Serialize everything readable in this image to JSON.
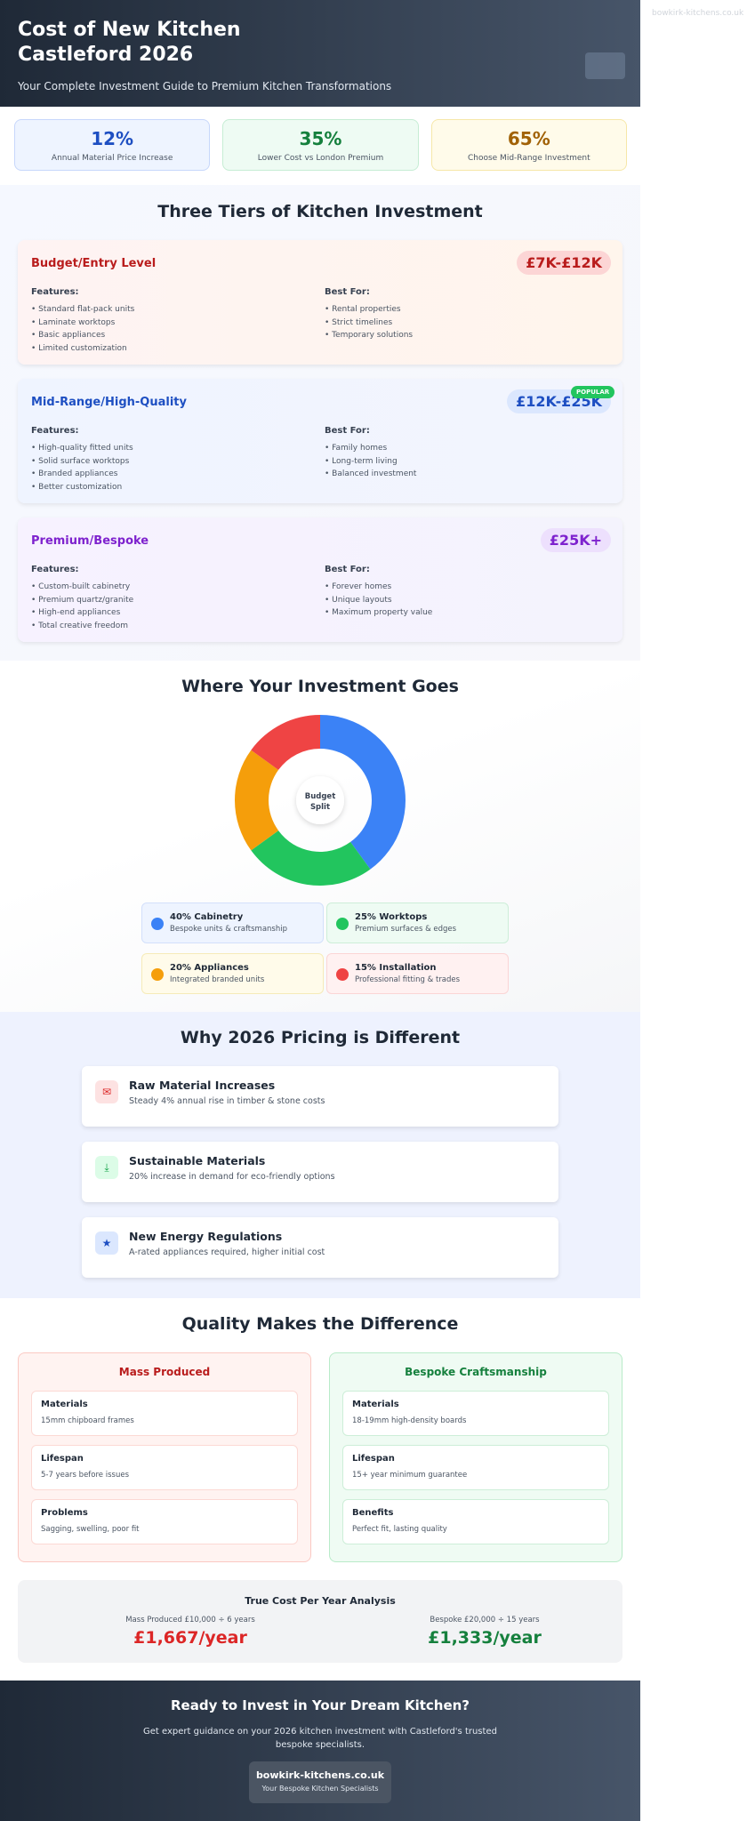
{
  "watermark": "bowkirk-kitchens.co.uk",
  "header": {
    "title": "Cost of New Kitchen Castleford 2026",
    "subtitle": "Your Complete Investment Guide to Premium Kitchen Transformations"
  },
  "stats": [
    {
      "value": "12%",
      "label": "Annual Material Price Increase"
    },
    {
      "value": "35%",
      "label": "Lower Cost vs London Premium"
    },
    {
      "value": "65%",
      "label": "Choose Mid-Range Investment"
    }
  ],
  "tiers": {
    "title": "Three Tiers of Kitchen Investment",
    "features_heading": "Features:",
    "best_for_heading": "Best For:",
    "popular_badge": "POPULAR",
    "items": [
      {
        "name": "Budget/Entry Level",
        "price": "£7K-£12K",
        "features": [
          "• Standard flat-pack units",
          "• Laminate worktops",
          "• Basic appliances",
          "• Limited customization"
        ],
        "best_for": [
          "• Rental properties",
          "• Strict timelines",
          "• Temporary solutions"
        ]
      },
      {
        "name": "Mid-Range/High-Quality",
        "price": "£12K-£25K",
        "features": [
          "• High-quality fitted units",
          "• Solid surface worktops",
          "• Branded appliances",
          "• Better customization"
        ],
        "best_for": [
          "• Family homes",
          "• Long-term living",
          "• Balanced investment"
        ]
      },
      {
        "name": "Premium/Bespoke",
        "price": "£25K+",
        "features": [
          "• Custom-built cabinetry",
          "• Premium quartz/granite",
          "• High-end appliances",
          "• Total creative freedom"
        ],
        "best_for": [
          "• Forever homes",
          "• Unique layouts",
          "• Maximum property value"
        ]
      }
    ]
  },
  "investment": {
    "title": "Where Your Investment Goes",
    "center_label_1": "Budget",
    "center_label_2": "Split",
    "legend": [
      {
        "title": "40% Cabinetry",
        "sub": "Bespoke units & craftsmanship"
      },
      {
        "title": "25% Worktops",
        "sub": "Premium surfaces & edges"
      },
      {
        "title": "20% Appliances",
        "sub": "Integrated branded units"
      },
      {
        "title": "15% Installation",
        "sub": "Professional fitting & trades"
      }
    ]
  },
  "chart_data": {
    "type": "pie",
    "categories": [
      "Cabinetry",
      "Worktops",
      "Appliances",
      "Installation"
    ],
    "values": [
      40,
      25,
      20,
      15
    ],
    "colors": [
      "#3b82f6",
      "#22c55e",
      "#f59e0b",
      "#ef4444"
    ],
    "title": "Where Your Investment Goes"
  },
  "why": {
    "title": "Why 2026 Pricing is Different",
    "items": [
      {
        "icon": "envelope-icon",
        "title": "Raw Material Increases",
        "sub": "Steady 4% annual rise in timber & stone costs"
      },
      {
        "icon": "download-icon",
        "title": "Sustainable Materials",
        "sub": "20% increase in demand for eco-friendly options"
      },
      {
        "icon": "star-icon",
        "title": "New Energy Regulations",
        "sub": "A-rated appliances required, higher initial cost"
      }
    ]
  },
  "quality": {
    "title": "Quality Makes the Difference",
    "mass": {
      "heading": "Mass Produced",
      "rows": [
        {
          "title": "Materials",
          "value": "15mm chipboard frames"
        },
        {
          "title": "Lifespan",
          "value": "5-7 years before issues"
        },
        {
          "title": "Problems",
          "value": "Sagging, swelling, poor fit"
        }
      ]
    },
    "bespoke": {
      "heading": "Bespoke Craftsmanship",
      "rows": [
        {
          "title": "Materials",
          "value": "18-19mm high-density boards"
        },
        {
          "title": "Lifespan",
          "value": "15+ year minimum guarantee"
        },
        {
          "title": "Benefits",
          "value": "Perfect fit, lasting quality"
        }
      ]
    },
    "true_cost": {
      "title": "True Cost Per Year Analysis",
      "mass_label": "Mass Produced £10,000 ÷ 6 years",
      "mass_value": "£1,667/year",
      "bespoke_label": "Bespoke £20,000 ÷ 15 years",
      "bespoke_value": "£1,333/year"
    }
  },
  "footer": {
    "title": "Ready to Invest in Your Dream Kitchen?",
    "sub": "Get expert guidance on your 2026 kitchen investment with Castleford's trusted bespoke specialists.",
    "site": "bowkirk-kitchens.co.uk",
    "tagline": "Your Bespoke Kitchen Specialists"
  }
}
